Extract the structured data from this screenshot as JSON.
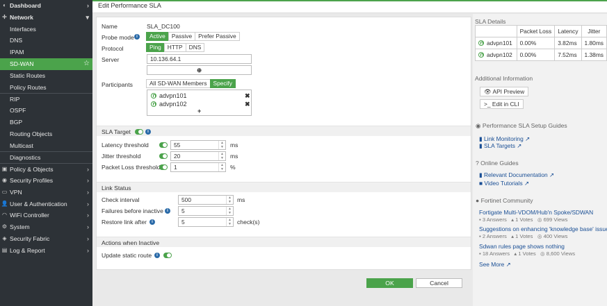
{
  "sidebar": {
    "items": [
      {
        "label": "Dashboard",
        "icon": "dashboard-icon",
        "glyph": "◐",
        "chevron": true
      },
      {
        "label": "Network",
        "icon": "network-icon",
        "glyph": "✛",
        "chevron": true,
        "expanded": true
      },
      {
        "label": "Interfaces"
      },
      {
        "label": "DNS"
      },
      {
        "label": "IPAM"
      },
      {
        "label": "SD-WAN",
        "active": true
      },
      {
        "label": "Static Routes"
      },
      {
        "label": "Policy Routes"
      },
      {
        "label": "RIP"
      },
      {
        "label": "OSPF"
      },
      {
        "label": "BGP"
      },
      {
        "label": "Routing Objects"
      },
      {
        "label": "Multicast"
      },
      {
        "label": "Diagnostics"
      },
      {
        "label": "Policy & Objects",
        "icon": "policy-icon",
        "glyph": "▣",
        "chevron": true
      },
      {
        "label": "Security Profiles",
        "icon": "security-icon",
        "glyph": "◉",
        "chevron": true
      },
      {
        "label": "VPN",
        "icon": "vpn-icon",
        "glyph": "▭",
        "chevron": true
      },
      {
        "label": "User & Authentication",
        "icon": "user-icon",
        "glyph": "👤",
        "chevron": true
      },
      {
        "label": "WiFi Controller",
        "icon": "wifi-icon",
        "glyph": "◠",
        "chevron": true
      },
      {
        "label": "System",
        "icon": "system-icon",
        "glyph": "⚙",
        "chevron": true
      },
      {
        "label": "Security Fabric",
        "icon": "fabric-icon",
        "glyph": "◈",
        "chevron": true
      },
      {
        "label": "Log & Report",
        "icon": "log-icon",
        "glyph": "▤",
        "chevron": true
      }
    ]
  },
  "header": {
    "title": "Edit Performance SLA"
  },
  "form": {
    "name_label": "Name",
    "name_value": "SLA_DC100",
    "probe_mode_label": "Probe mode",
    "probe_modes": [
      "Active",
      "Passive",
      "Prefer Passive"
    ],
    "protocol_label": "Protocol",
    "protocols": [
      "Ping",
      "HTTP",
      "DNS"
    ],
    "server_label": "Server",
    "server_value": "10.136.64.1",
    "participants_label": "Participants",
    "participant_modes": [
      "All SD-WAN Members",
      "Specify"
    ],
    "participants": [
      "advpn101",
      "advpn102"
    ],
    "sla_target_label": "SLA Target",
    "latency_label": "Latency threshold",
    "latency_value": "55",
    "latency_unit": "ms",
    "jitter_label": "Jitter threshold",
    "jitter_value": "20",
    "jitter_unit": "ms",
    "loss_label": "Packet Loss threshold",
    "loss_value": "1",
    "loss_unit": "%",
    "link_status_label": "Link Status",
    "check_interval_label": "Check interval",
    "check_interval_value": "500",
    "check_interval_unit": "ms",
    "failures_label": "Failures before inactive",
    "failures_value": "5",
    "restore_label": "Restore link after",
    "restore_value": "5",
    "restore_unit": "check(s)",
    "actions_label": "Actions when Inactive",
    "update_route_label": "Update static route"
  },
  "right": {
    "sla_details_title": "SLA Details",
    "sla_columns": [
      "",
      "Packet Loss",
      "Latency",
      "Jitter"
    ],
    "sla_rows": [
      {
        "name": "advpn101",
        "loss": "0.00%",
        "latency": "3.82ms",
        "jitter": "1.80ms"
      },
      {
        "name": "advpn102",
        "loss": "0.00%",
        "latency": "7.52ms",
        "jitter": "1.38ms"
      }
    ],
    "additional_info_title": "Additional Information",
    "api_preview_label": "API Preview",
    "edit_cli_label": "Edit in CLI",
    "setup_guides_title": "Performance SLA Setup Guides",
    "setup_guides": [
      "Link Monitoring",
      "SLA Targets"
    ],
    "online_guides_title": "Online Guides",
    "online_guides": [
      "Relevant Documentation",
      "Video Tutorials"
    ],
    "community_title": "Fortinet Community",
    "community_posts": [
      {
        "title": "Fortigate Multi-VDOM/Hub'n Spoke/SDWAN",
        "answers": "3 Answers",
        "votes": "1 Votes",
        "views": "699 Views"
      },
      {
        "title": "Suggestions on enhancing 'knowledge base' issues/c",
        "answers": "2 Answers",
        "votes": "1 Votes",
        "views": "400 Views"
      },
      {
        "title": "Sdwan rules page shows nothing",
        "answers": "18 Answers",
        "votes": "1 Votes",
        "views": "8,600 Views"
      }
    ],
    "see_more_label": "See More"
  },
  "footer": {
    "ok_label": "OK",
    "cancel_label": "Cancel"
  },
  "colors": {
    "accent": "#4ba34b",
    "sidebar_bg": "#2d3237",
    "link": "#1a4f95"
  }
}
